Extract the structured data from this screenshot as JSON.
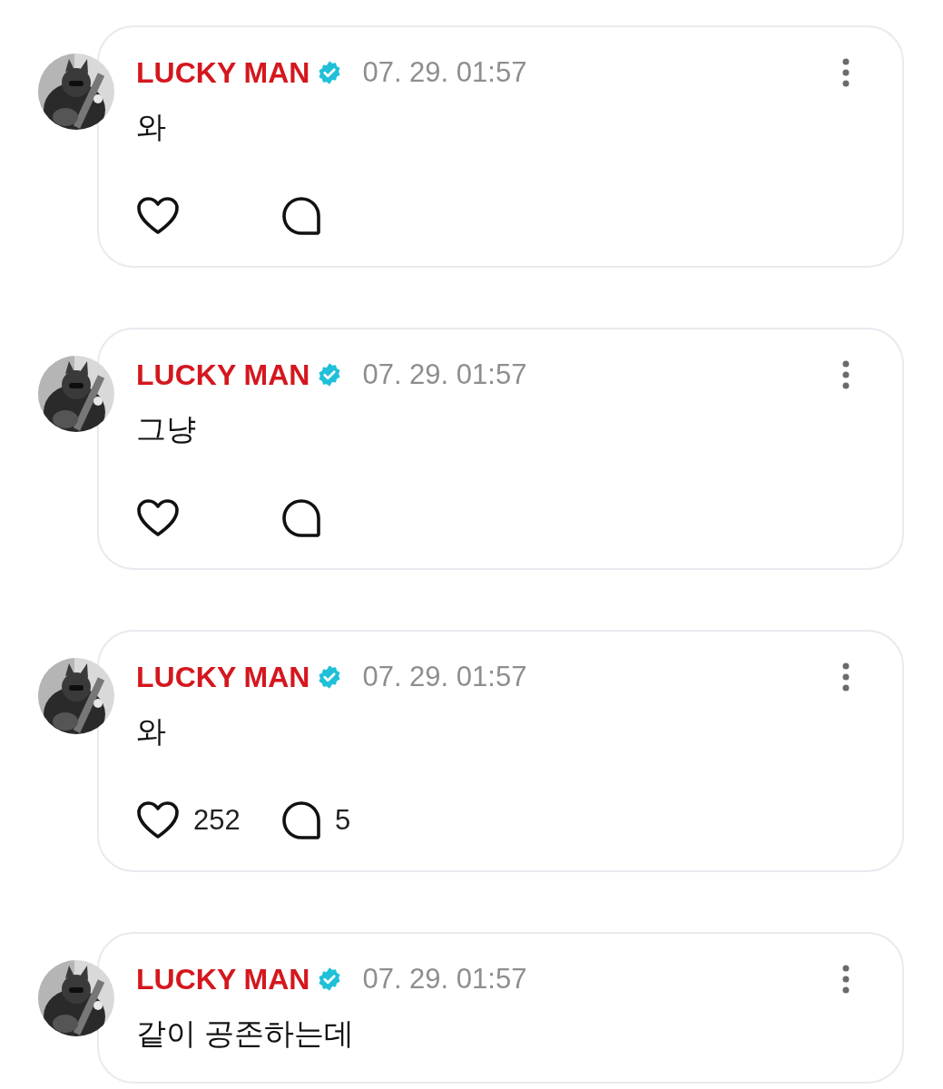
{
  "posts": [
    {
      "author": "LUCKY MAN",
      "verified": true,
      "time": "07. 29. 01:57",
      "text": "와",
      "actions_shown": true
    },
    {
      "author": "LUCKY MAN",
      "verified": true,
      "time": "07. 29. 01:57",
      "text": "그냥",
      "actions_shown": true
    },
    {
      "author": "LUCKY MAN",
      "verified": true,
      "time": "07. 29. 01:57",
      "text": "와",
      "actions_shown": true,
      "likes": "252",
      "replies": "5"
    },
    {
      "author": "LUCKY MAN",
      "verified": true,
      "time": "07. 29. 01:57",
      "text": "같이 공존하는데",
      "actions_shown": false
    }
  ]
}
